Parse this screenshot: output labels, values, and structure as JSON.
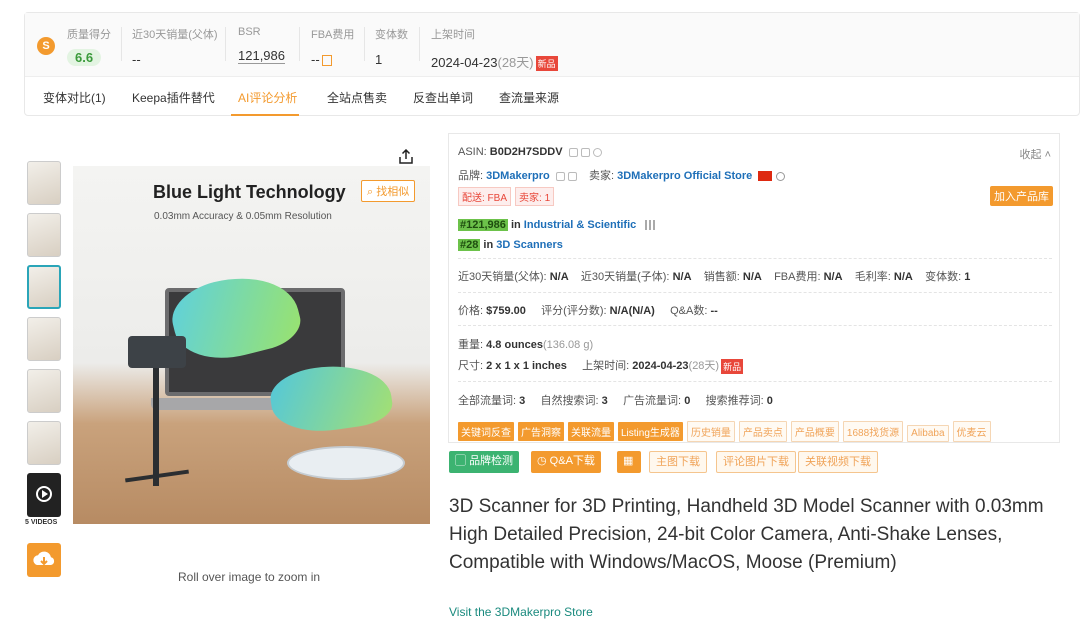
{
  "stats": {
    "quality_label": "质量得分",
    "quality_value": "6.6",
    "sales30_parent_label": "近30天销量(父体)",
    "sales30_parent_value": "--",
    "bsr_label": "BSR",
    "bsr_value": "121,986",
    "fba_label": "FBA费用",
    "fba_value": "--",
    "variants_label": "变体数",
    "variants_value": "1",
    "listed_label": "上架时间",
    "listed_date": "2024-04-23",
    "listed_days": "(28天)",
    "new_tag": "新品"
  },
  "tabs": [
    {
      "label": "变体对比(1)"
    },
    {
      "label": "Keepa插件替代"
    },
    {
      "label": "AI评论分析"
    },
    {
      "label": "全站点售卖"
    },
    {
      "label": "反查出单词"
    },
    {
      "label": "查流量来源"
    }
  ],
  "image": {
    "title": "Blue Light Technology",
    "subtitle": "0.03mm Accuracy & 0.05mm Resolution",
    "find_similar": "找相似",
    "videos_label": "5 VIDEOS",
    "zoom_hint": "Roll over image to zoom in"
  },
  "info": {
    "asin_label": "ASIN:",
    "asin": "B0D2H7SDDV",
    "collapse": "收起",
    "brand_label": "品牌:",
    "brand": "3DMakerpro",
    "seller_label": "卖家:",
    "seller": "3DMakerpro Official Store",
    "delivery_tag": "配送: FBA",
    "seller_count_tag": "卖家: 1",
    "add_library": "加入产品库",
    "rank1": "#121,986",
    "rank1_in": "in",
    "rank1_cat": "Industrial & Scientific",
    "rank2": "#28",
    "rank2_in": "in",
    "rank2_cat": "3D Scanners",
    "sales_parent_label": "近30天销量(父体):",
    "sales_parent": "N/A",
    "sales_child_label": "近30天销量(子体):",
    "sales_child": "N/A",
    "revenue_label": "销售额:",
    "revenue": "N/A",
    "fba_label": "FBA费用:",
    "fba": "N/A",
    "margin_label": "毛利率:",
    "margin": "N/A",
    "variants_label": "变体数:",
    "variants": "1",
    "price_label": "价格:",
    "price": "$759.00",
    "rating_label": "评分(评分数):",
    "rating": "N/A(N/A)",
    "qa_label": "Q&A数:",
    "qa": "--",
    "weight_label": "重量:",
    "weight": "4.8 ounces",
    "weight_g": "(136.08 g)",
    "size_label": "尺寸:",
    "size": "2 x 1 x 1 inches",
    "listed_label": "上架时间:",
    "listed": "2024-04-23",
    "listed_days": "(28天)",
    "new_tag": "新品",
    "kw_all_label": "全部流量词:",
    "kw_all": "3",
    "kw_organic_label": "自然搜索词:",
    "kw_organic": "3",
    "kw_ad_label": "广告流量词:",
    "kw_ad": "0",
    "kw_rec_label": "搜索推荐词:",
    "kw_rec": "0",
    "tool_tags": [
      {
        "label": "关键词反查",
        "style": "solid"
      },
      {
        "label": "广告洞察",
        "style": "solid"
      },
      {
        "label": "关联流量",
        "style": "solid"
      },
      {
        "label": "Listing生成器",
        "style": "solid"
      },
      {
        "label": "历史销量",
        "style": "light"
      },
      {
        "label": "产品卖点",
        "style": "light"
      },
      {
        "label": "产品概要",
        "style": "light"
      },
      {
        "label": "1688找货源",
        "style": "light"
      },
      {
        "label": "Alibaba",
        "style": "light"
      },
      {
        "label": "优麦云",
        "style": "light"
      }
    ]
  },
  "actions": {
    "brand_check": "品牌检测",
    "qa_download": "Q&A下载",
    "main_img_download": "主图下载",
    "review_img_download": "评论图片下载",
    "related_video_download": "关联视频下载"
  },
  "product": {
    "title": "3D Scanner for 3D Printing, Handheld 3D Model Scanner with 0.03mm High Detailed Precision, 24-bit Color Camera, Anti-Shake Lenses, Compatible with Windows/MacOS, Moose (Premium)",
    "visit_store": "Visit the 3DMakerpro Store"
  },
  "colors": {
    "accent": "#f39a2e",
    "rank_green": "#6cc24a",
    "link_blue": "#1e6fb8",
    "teal": "#1a8a7e"
  }
}
